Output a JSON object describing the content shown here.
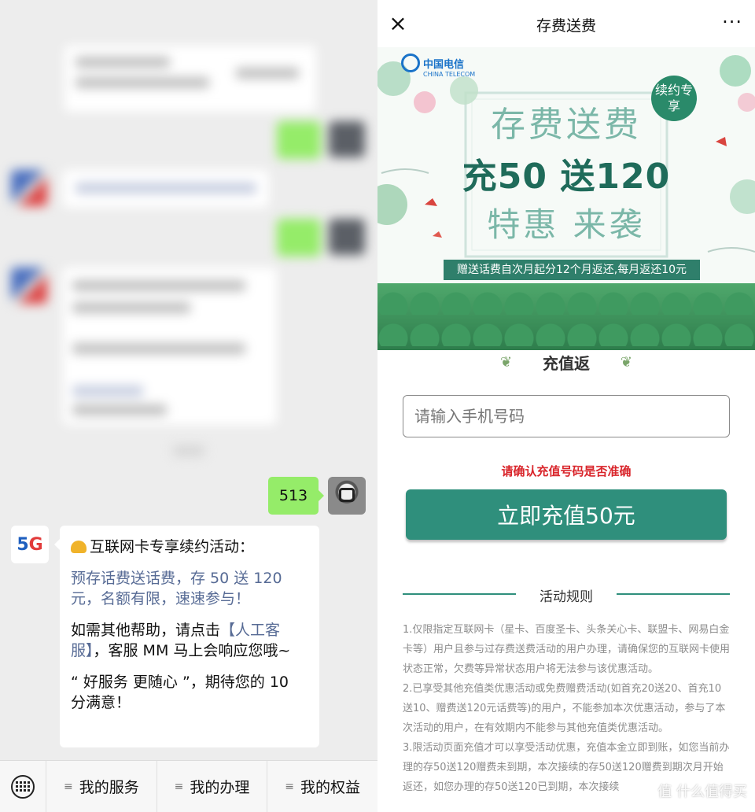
{
  "chat": {
    "sent_message": "513",
    "bot_message": {
      "line1": "互联网卡专享续约活动：",
      "promo_link": "预存话费送话费，存 50 送 120 元，名额有限，速速参与！",
      "help_prefix": "如需其他帮助，请点击",
      "help_link": "【人工客服】",
      "help_suffix": "，客服 MM 马上会响应您哦~",
      "closing": "“ 好服务 更随心 ”，期待您的 10 分满意！"
    },
    "bot_avatar": {
      "five": "5",
      "g": "G"
    },
    "menu": [
      "我的服务",
      "我的办理",
      "我的权益"
    ],
    "menu_icon": "≡"
  },
  "webview": {
    "close_icon": "×",
    "title": "存费送费",
    "more_icon": "···",
    "banner": {
      "logo_cn": "中国电信",
      "logo_en": "CHINA TELECOM",
      "badge": "续约专享",
      "headline1": "存费送费",
      "headline2": "充50 送120",
      "headline3": "特惠 来袭",
      "strip": "赠送话费自次月起分12个月返还,每月返还10元"
    },
    "recharge_heading": "充值返",
    "phone_placeholder": "请输入手机号码",
    "warning": "请确认充值号码是否准确",
    "pay_button": "立即充值50元",
    "rules_heading": "活动规则",
    "rules": [
      "1.仅限指定互联网卡（星卡、百度圣卡、头条关心卡、联盟卡、网易白金卡等）用户且参与过存费送费活动的用户办理，请确保您的互联网卡使用状态正常，欠费等异常状态用户将无法参与该优惠活动。",
      "2.已享受其他充值类优惠活动或免费赠费活动(如首充20送20、首充10送10、赠费送120元话费等)的用户，不能参加本次优惠活动，参与了本次活动的用户，在有效期内不能参与其他充值类优惠活动。",
      "3.限活动页面充值才可以享受活动优惠，充值本金立即到账，如您当前办理的存50送120赠费未到期，本次接续的存50送120赠费到期次月开始返还，如您办理的存50送120已到期，本次接续"
    ],
    "watermark": "值 什么值得买"
  }
}
